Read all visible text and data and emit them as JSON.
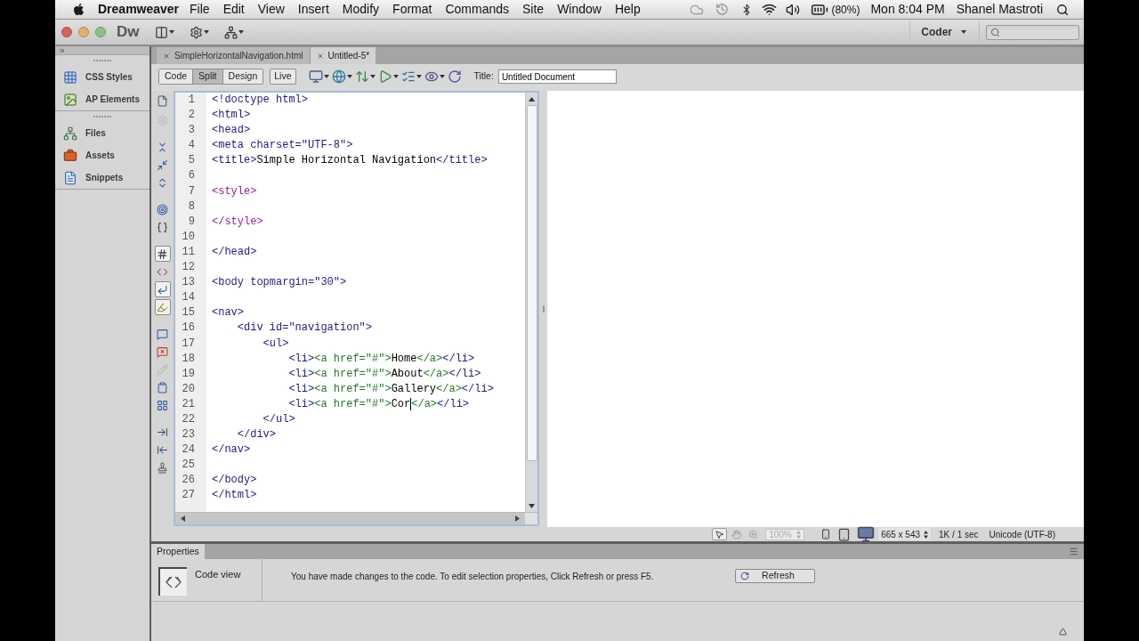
{
  "menu_bar": {
    "app_name": "Dreamweaver",
    "menus": [
      "File",
      "Edit",
      "View",
      "Insert",
      "Modify",
      "Format",
      "Commands",
      "Site",
      "Window",
      "Help"
    ],
    "battery": "(80%)",
    "clock": "Mon 8:04 PM",
    "user": "Shanel Mastroti"
  },
  "app_bar": {
    "logo": "Dw",
    "workspace": "Coder"
  },
  "panels": [
    {
      "items": [
        {
          "kind": "css",
          "label": "CSS Styles"
        },
        {
          "kind": "ap",
          "label": "AP Elements"
        }
      ]
    },
    {
      "items": [
        {
          "kind": "files",
          "label": "Files"
        },
        {
          "kind": "assets",
          "label": "Assets"
        },
        {
          "kind": "snippets",
          "label": "Snippets"
        }
      ]
    }
  ],
  "document_tabs": [
    {
      "label": "SimpleHorizontalNavigation.html",
      "selected": false
    },
    {
      "label": "Untitled-5*",
      "selected": true
    }
  ],
  "document_toolbar": {
    "views": [
      {
        "label": "Code",
        "selected": false
      },
      {
        "label": "Split",
        "selected": true
      },
      {
        "label": "Design",
        "selected": false
      }
    ],
    "live": {
      "label": "Live",
      "selected": false
    },
    "title_label": "Title:",
    "title_value": "Untitled Document"
  },
  "coding_toolbar": [
    {
      "tools": [
        {
          "kind": "documents",
          "pressed": false,
          "disabled": false
        },
        {
          "kind": "navigator",
          "pressed": false,
          "disabled": true
        }
      ]
    },
    {
      "tools": [
        {
          "kind": "collapsetag",
          "pressed": false,
          "disabled": false
        },
        {
          "kind": "collapseselection",
          "pressed": false,
          "disabled": false
        },
        {
          "kind": "expandall",
          "pressed": false,
          "disabled": false
        }
      ]
    },
    {
      "tools": [
        {
          "kind": "parent",
          "pressed": false,
          "disabled": false
        },
        {
          "kind": "braces",
          "pressed": false,
          "disabled": false
        }
      ]
    },
    {
      "tools": [
        {
          "kind": "numbers",
          "pressed": true,
          "disabled": false
        },
        {
          "kind": "invalid",
          "pressed": false,
          "disabled": false
        },
        {
          "kind": "wrap",
          "pressed": true,
          "disabled": false
        },
        {
          "kind": "highlight",
          "pressed": true,
          "disabled": false
        }
      ]
    },
    {
      "tools": [
        {
          "kind": "comment",
          "pressed": false,
          "disabled": false
        },
        {
          "kind": "uncomment",
          "pressed": false,
          "disabled": false
        },
        {
          "kind": "wraptag",
          "pressed": false,
          "disabled": true
        },
        {
          "kind": "snippets",
          "pressed": false,
          "disabled": false
        },
        {
          "kind": "movecss",
          "pressed": false,
          "disabled": false
        }
      ]
    },
    {
      "tools": [
        {
          "kind": "indent",
          "pressed": false,
          "disabled": false
        },
        {
          "kind": "outdent",
          "pressed": false,
          "disabled": false
        },
        {
          "kind": "format",
          "pressed": false,
          "disabled": false
        }
      ]
    }
  ],
  "code": {
    "lines": [
      {
        "number": "1",
        "tokens": [
          {
            "kind": "tag",
            "text": "<!doctype html>"
          }
        ]
      },
      {
        "number": "2",
        "tokens": [
          {
            "kind": "tag",
            "text": "<html>"
          }
        ]
      },
      {
        "number": "3",
        "tokens": [
          {
            "kind": "tag",
            "text": "<head>"
          }
        ]
      },
      {
        "number": "4",
        "tokens": [
          {
            "kind": "tag",
            "text": "<meta charset=\"UTF-8\">"
          }
        ]
      },
      {
        "number": "5",
        "tokens": [
          {
            "kind": "tag",
            "text": "<title>"
          },
          {
            "kind": "text",
            "text": "Simple Horizontal Navigation"
          },
          {
            "kind": "tag",
            "text": "</title>"
          }
        ]
      },
      {
        "number": "6"
      },
      {
        "number": "7",
        "tokens": [
          {
            "kind": "style",
            "text": "<style>"
          }
        ]
      },
      {
        "number": "8"
      },
      {
        "number": "9",
        "tokens": [
          {
            "kind": "style",
            "text": "</style>"
          }
        ]
      },
      {
        "number": "10"
      },
      {
        "number": "11",
        "tokens": [
          {
            "kind": "tag",
            "text": "</head>"
          }
        ]
      },
      {
        "number": "12"
      },
      {
        "number": "13",
        "tokens": [
          {
            "kind": "tag",
            "text": "<body topmargin=\"30\">"
          }
        ]
      },
      {
        "number": "14"
      },
      {
        "number": "15",
        "tokens": [
          {
            "kind": "tag",
            "text": "<nav>"
          }
        ],
        "children": [
          {
            "number": "16",
            "tokens": [
              {
                "kind": "tag",
                "text": "<div id=\"navigation\">"
              }
            ],
            "children": [
              {
                "number": "17",
                "tokens": [
                  {
                    "kind": "tag",
                    "text": "<ul>"
                  }
                ],
                "children": [
                  {
                    "number": "18",
                    "tokens": [
                      {
                        "kind": "tag",
                        "text": "<li>"
                      },
                      {
                        "kind": "anchor",
                        "text": "<a href=\"#\">"
                      },
                      {
                        "kind": "text",
                        "text": "Home"
                      },
                      {
                        "kind": "anchor",
                        "text": "</a>"
                      },
                      {
                        "kind": "tag",
                        "text": "</li>"
                      }
                    ]
                  },
                  {
                    "number": "19",
                    "tokens": [
                      {
                        "kind": "tag",
                        "text": "<li>"
                      },
                      {
                        "kind": "anchor",
                        "text": "<a href=\"#\">"
                      },
                      {
                        "kind": "text",
                        "text": "About"
                      },
                      {
                        "kind": "anchor",
                        "text": "</a>"
                      },
                      {
                        "kind": "tag",
                        "text": "</li>"
                      }
                    ]
                  },
                  {
                    "number": "20",
                    "tokens": [
                      {
                        "kind": "tag",
                        "text": "<li>"
                      },
                      {
                        "kind": "anchor",
                        "text": "<a href=\"#\">"
                      },
                      {
                        "kind": "text",
                        "text": "Gallery"
                      },
                      {
                        "kind": "anchor",
                        "text": "</a>"
                      },
                      {
                        "kind": "tag",
                        "text": "</li>"
                      }
                    ]
                  },
                  {
                    "number": "21",
                    "tokens": [
                      {
                        "kind": "tag",
                        "text": "<li>"
                      },
                      {
                        "kind": "anchor",
                        "text": "<a href=\"#\">"
                      },
                      {
                        "kind": "text",
                        "text": "Cor",
                        "caret": true
                      },
                      {
                        "kind": "anchor",
                        "text": "</a>"
                      },
                      {
                        "kind": "tag",
                        "text": "</li>"
                      }
                    ]
                  }
                ]
              },
              {
                "number": "22",
                "tokens": [
                  {
                    "kind": "tag",
                    "text": "</ul>"
                  }
                ]
              }
            ]
          },
          {
            "number": "23",
            "tokens": [
              {
                "kind": "tag",
                "text": "</div>"
              }
            ]
          }
        ]
      },
      {
        "number": "24",
        "tokens": [
          {
            "kind": "tag",
            "text": "</nav>"
          }
        ]
      },
      {
        "number": "25"
      },
      {
        "number": "26",
        "tokens": [
          {
            "kind": "tag",
            "text": "</body>"
          }
        ]
      },
      {
        "number": "27",
        "tokens": [
          {
            "kind": "tag",
            "text": "</html>"
          }
        ]
      }
    ]
  },
  "status_bar": {
    "tools": [
      {
        "kind": "pointer",
        "selected": true
      },
      {
        "kind": "hand",
        "selected": false
      },
      {
        "kind": "zoom",
        "selected": false
      }
    ],
    "zoom": {
      "value": "100%",
      "disabled": true
    },
    "screens": [
      {
        "kind": "mobile",
        "selected": false
      },
      {
        "kind": "tablet",
        "selected": false
      },
      {
        "kind": "desktop",
        "selected": true
      }
    ],
    "window_size": "665 x 543",
    "download": "1K / 1 sec",
    "encoding": "Unicode (UTF-8)"
  },
  "properties": {
    "tab": "Properties",
    "mode": "Code view",
    "message": "You have made changes to the code. To edit selection properties, Click Refresh or press F5.",
    "button": "Refresh"
  }
}
